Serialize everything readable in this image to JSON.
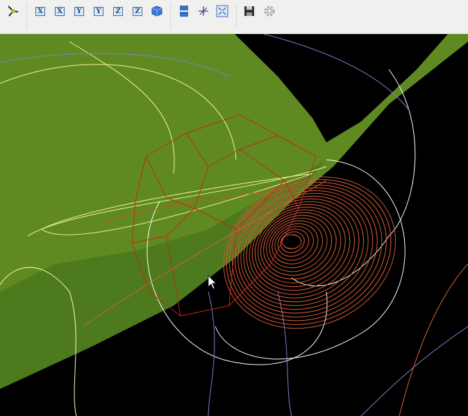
{
  "toolbar": {
    "buttons": [
      {
        "name": "orientation-button",
        "icon": "axes-tripod-icon"
      },
      {
        "name": "view-x-pos-button",
        "label": "X"
      },
      {
        "name": "view-x-neg-button",
        "label": "X"
      },
      {
        "name": "view-y-pos-button",
        "label": "Y"
      },
      {
        "name": "view-y-neg-button",
        "label": "Y"
      },
      {
        "name": "view-z-pos-button",
        "label": "Z"
      },
      {
        "name": "view-z-neg-button",
        "label": "Z"
      },
      {
        "name": "view-3d-button",
        "icon": "cube-icon"
      },
      {
        "name": "layout-button",
        "icon": "split-layout-icon"
      },
      {
        "name": "axes-button",
        "icon": "axes-icon"
      },
      {
        "name": "fullscreen-button",
        "icon": "fullscreen-icon"
      },
      {
        "name": "save-button",
        "icon": "save-icon"
      },
      {
        "name": "settings-button",
        "icon": "gear-icon"
      }
    ]
  },
  "colors": {
    "surface": "#5f8a22",
    "background": "#000000",
    "attractor": "#e0603a",
    "cage": "#c0281c",
    "curve_yellow": "#f4f49a",
    "curve_purple": "#8a7ad0"
  }
}
